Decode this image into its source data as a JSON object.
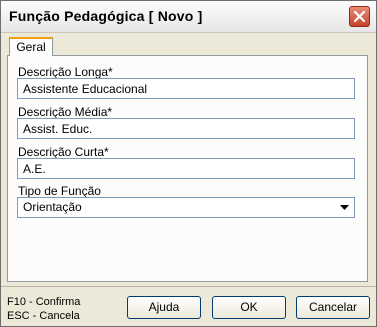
{
  "window": {
    "title": "Função Pedagógica [ Novo ]"
  },
  "tabs": [
    {
      "label": "Geral"
    }
  ],
  "form": {
    "descricao_longa": {
      "label": "Descrição Longa*",
      "value": "Assistente Educacional"
    },
    "descricao_media": {
      "label": "Descrição Média*",
      "value": "Assist. Educ."
    },
    "descricao_curta": {
      "label": "Descrição Curta*",
      "value": "A.E."
    },
    "tipo_funcao": {
      "label": "Tipo de Função",
      "value": "Orientação"
    }
  },
  "footer": {
    "hint_confirm": "F10 - Confirma",
    "hint_cancel": "ESC - Cancela",
    "help_label": "Ajuda",
    "ok_label": "OK",
    "cancel_label": "Cancelar"
  },
  "icons": {
    "close": "close-icon",
    "dropdown": "chevron-down-icon"
  }
}
